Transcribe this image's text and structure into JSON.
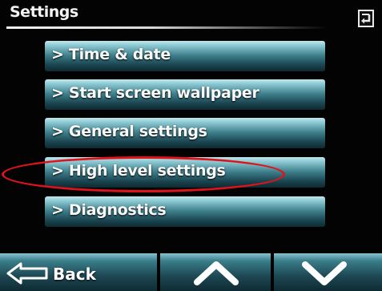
{
  "header": {
    "title": "Settings",
    "return_icon": "return-arrow-icon"
  },
  "menu": {
    "items": [
      {
        "label": "> Time & date"
      },
      {
        "label": "> Start screen wallpaper"
      },
      {
        "label": "> General settings"
      },
      {
        "label": "> High level settings"
      },
      {
        "label": "> Diagnostics"
      }
    ],
    "highlighted_item": "> High level settings"
  },
  "footer": {
    "back_label": "Back",
    "back_icon": "back-arrow-icon",
    "up_icon": "chevron-up-icon",
    "down_icon": "chevron-down-icon"
  },
  "colors": {
    "accent": "#3d7f8b",
    "highlight_ring": "#e0131c",
    "background": "#030303"
  }
}
